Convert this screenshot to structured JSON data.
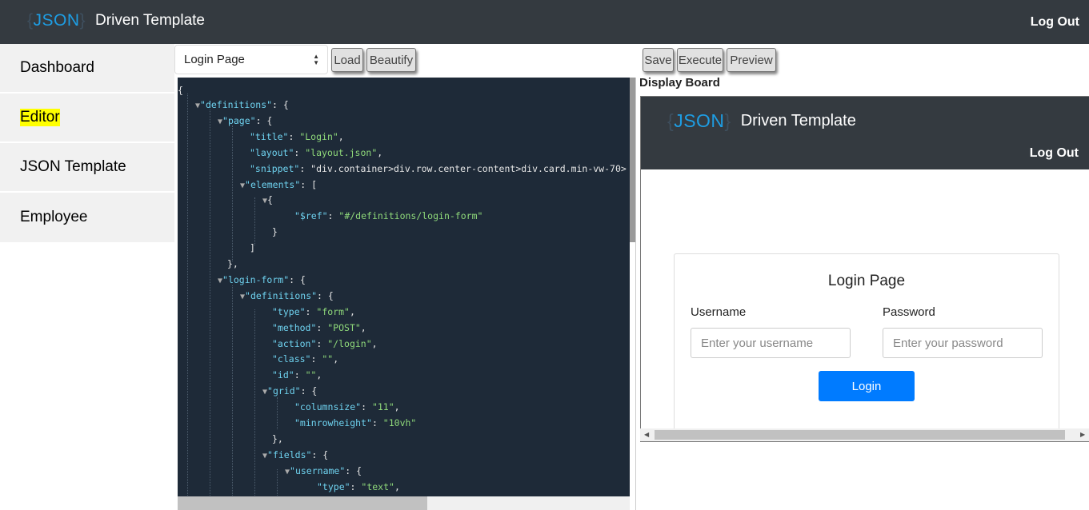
{
  "header": {
    "logo": "{JSON}",
    "title": "Driven Template",
    "logout": "Log Out"
  },
  "sidebar": {
    "items": [
      {
        "label": "Dashboard"
      },
      {
        "label": "Editor"
      },
      {
        "label": "JSON Template"
      },
      {
        "label": "Employee"
      }
    ]
  },
  "editor": {
    "selected_template": "Login Page",
    "load_label": "Load",
    "beautify_label": "Beautify"
  },
  "actions": {
    "save_label": "Save",
    "execute_label": "Execute",
    "preview_label": "Preview"
  },
  "display_board": {
    "label": "Display Board",
    "logo": "{JSON}",
    "title": "Driven Template",
    "logout": "Log Out",
    "card_title": "Login Page",
    "username_label": "Username",
    "username_placeholder": "Enter your username",
    "password_label": "Password",
    "password_placeholder": "Enter your password",
    "login_label": "Login"
  },
  "code_lines": [
    "{",
    "\"definitions\": {",
    "\"page\": {",
    "\"title\": \"Login\",",
    "\"layout\": \"layout.json\",",
    "\"snippet\": \"div.container>div.row.center-content>div.card.min-vw-70>",
    "\"elements\": [",
    "{",
    "\"$ref\": \"#/definitions/login-form\"",
    "}",
    "]",
    "},",
    "\"login-form\": {",
    "\"definitions\": {",
    "\"type\": \"form\",",
    "\"method\": \"POST\",",
    "\"action\": \"/login\",",
    "\"class\": \"\",",
    "\"id\": \"\",",
    "\"grid\": {",
    "\"columnsize\": \"11\",",
    "\"minrowheight\": \"10vh\"",
    "},",
    "\"fields\": {",
    "\"username\": {",
    "\"type\": \"text\","
  ]
}
